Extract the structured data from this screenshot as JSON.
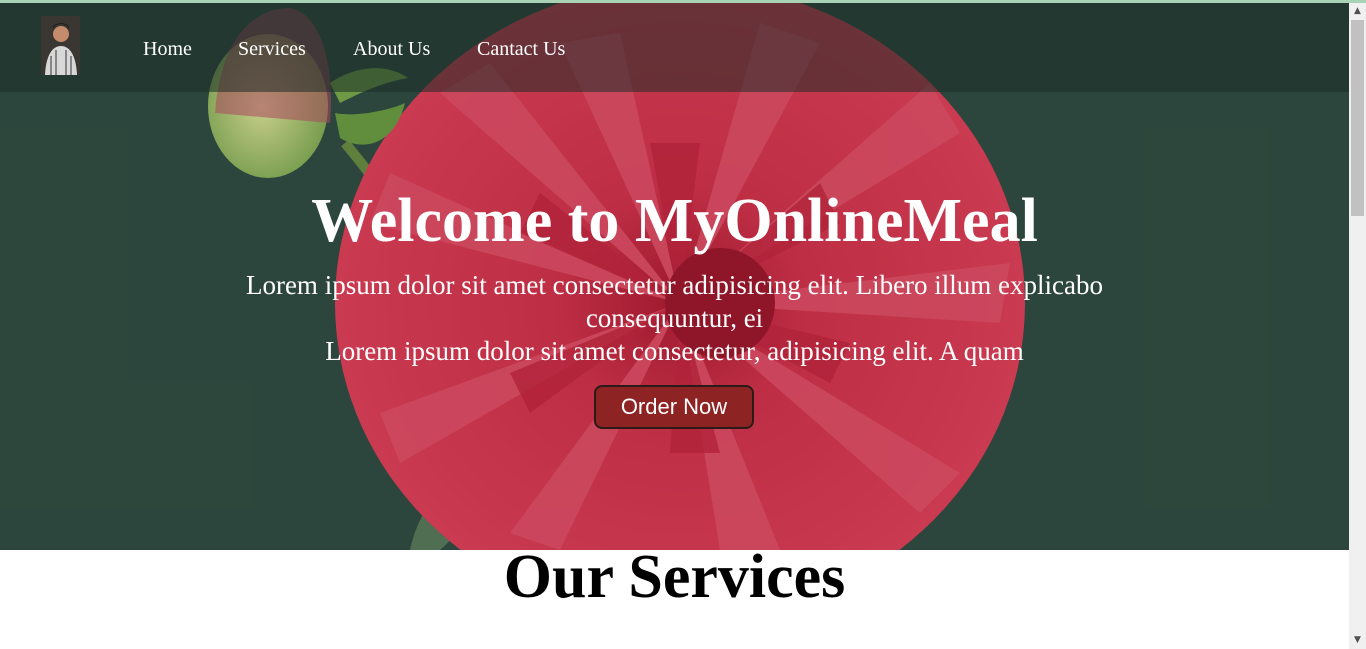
{
  "nav": {
    "items": [
      {
        "label": "Home"
      },
      {
        "label": "Services"
      },
      {
        "label": "About Us"
      },
      {
        "label": "Cantact Us"
      }
    ]
  },
  "hero": {
    "title": "Welcome to MyOnlineMeal",
    "text_line1": "Lorem ipsum dolor sit amet consectetur adipisicing elit. Libero illum explicabo consequuntur, ei",
    "text_line2": "Lorem ipsum dolor sit amet consectetur, adipisicing elit. A quam",
    "button_label": "Order Now",
    "background_icon": "flower-photo-icon",
    "colors": {
      "overlay": "#2f4a40",
      "flower": "#e42c48",
      "button": "#8e2323"
    }
  },
  "services": {
    "title": "Our Services"
  },
  "logo_icon": "profile-avatar-icon"
}
